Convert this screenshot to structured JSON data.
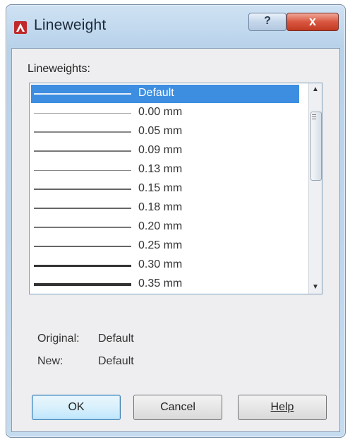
{
  "window": {
    "title": "Lineweight",
    "help_glyph": "?",
    "close_glyph": "x"
  },
  "lineweights": {
    "label": "Lineweights:",
    "items": [
      {
        "label": "Default",
        "weight": 2,
        "shade": "#999999",
        "selected": true
      },
      {
        "label": "0.00 mm",
        "weight": 1,
        "shade": "#aaaaaa"
      },
      {
        "label": "0.05 mm",
        "weight": 2,
        "shade": "#888888"
      },
      {
        "label": "0.09 mm",
        "weight": 2,
        "shade": "#777777"
      },
      {
        "label": "0.13 mm",
        "weight": 1,
        "shade": "#888888"
      },
      {
        "label": "0.15 mm",
        "weight": 2,
        "shade": "#666666"
      },
      {
        "label": "0.18 mm",
        "weight": 2,
        "shade": "#666666"
      },
      {
        "label": "0.20 mm",
        "weight": 2,
        "shade": "#777777"
      },
      {
        "label": "0.25 mm",
        "weight": 2,
        "shade": "#666666"
      },
      {
        "label": "0.30 mm",
        "weight": 3,
        "shade": "#333333"
      },
      {
        "label": "0.35 mm",
        "weight": 4,
        "shade": "#333333"
      }
    ]
  },
  "info": {
    "original_label": "Original:",
    "original_value": "Default",
    "new_label": "New:",
    "new_value": "Default"
  },
  "buttons": {
    "ok": "OK",
    "cancel": "Cancel",
    "help": "Help"
  },
  "colors": {
    "selection": "#3d8ee0",
    "close_button": "#c23b22"
  }
}
